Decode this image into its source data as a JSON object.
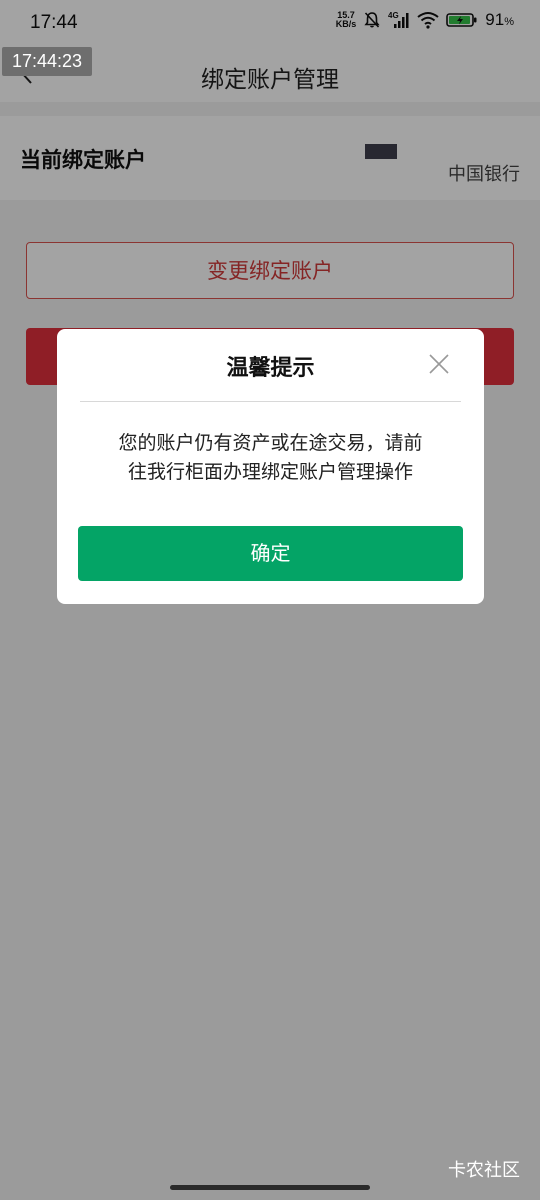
{
  "status_bar": {
    "time": "17:44",
    "net_speed_value": "15.7",
    "net_speed_unit": "KB/s",
    "network": "4G",
    "battery_percent": "91",
    "battery_unit": "%",
    "icons": [
      "bell-muted-icon",
      "signal-icon",
      "wifi-icon",
      "battery-charging-icon"
    ]
  },
  "timestamp_overlay": "17:44:23",
  "navbar": {
    "title": "绑定账户管理",
    "back_icon": "chevron-left-icon"
  },
  "account": {
    "label": "当前绑定账户",
    "bank": "中国银行"
  },
  "buttons": {
    "change": "变更绑定账户"
  },
  "dialog": {
    "title": "温馨提示",
    "close_icon": "close-icon",
    "message_line1": "您的账户仍有资产或在途交易，请前",
    "message_line2": "往我行柜面办理绑定账户管理操作",
    "confirm": "确定"
  },
  "watermark": "卡农社区",
  "colors": {
    "primary_red": "#e0303c",
    "outline_red": "#d9534f",
    "confirm_green": "#04a466"
  }
}
